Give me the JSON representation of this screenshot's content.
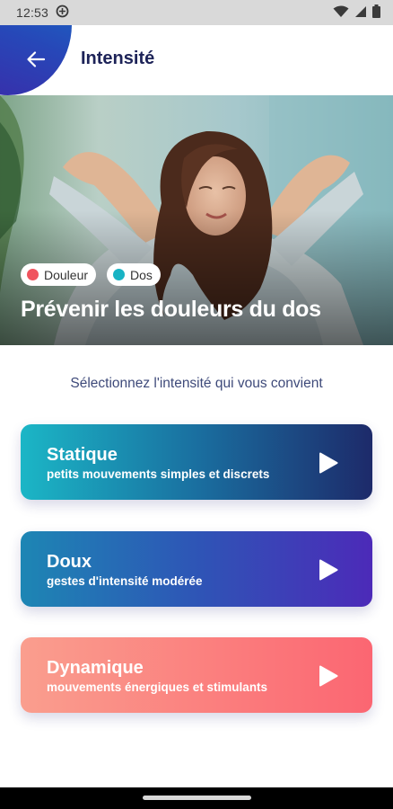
{
  "status_bar": {
    "time": "12:53",
    "icons": [
      "app-status-icon",
      "wifi-icon",
      "signal-icon",
      "battery-icon"
    ]
  },
  "header": {
    "title": "Intensité",
    "back_icon": "back-arrow-icon",
    "accent_color": "#2747b8"
  },
  "hero": {
    "tags": [
      {
        "label": "Douleur",
        "dot_color": "#f0545e"
      },
      {
        "label": "Dos",
        "dot_color": "#18b3c4"
      }
    ],
    "title": "Prévenir les douleurs du dos"
  },
  "subtitle": "Sélectionnez l'intensité qui vous convient",
  "options": [
    {
      "title": "Statique",
      "description": "petits mouvements simples et discrets",
      "icon": "play-icon"
    },
    {
      "title": "Doux",
      "description": "gestes d'intensité modérée",
      "icon": "play-icon"
    },
    {
      "title": "Dynamique",
      "description": "mouvements énergiques et stimulants",
      "icon": "play-icon"
    }
  ]
}
